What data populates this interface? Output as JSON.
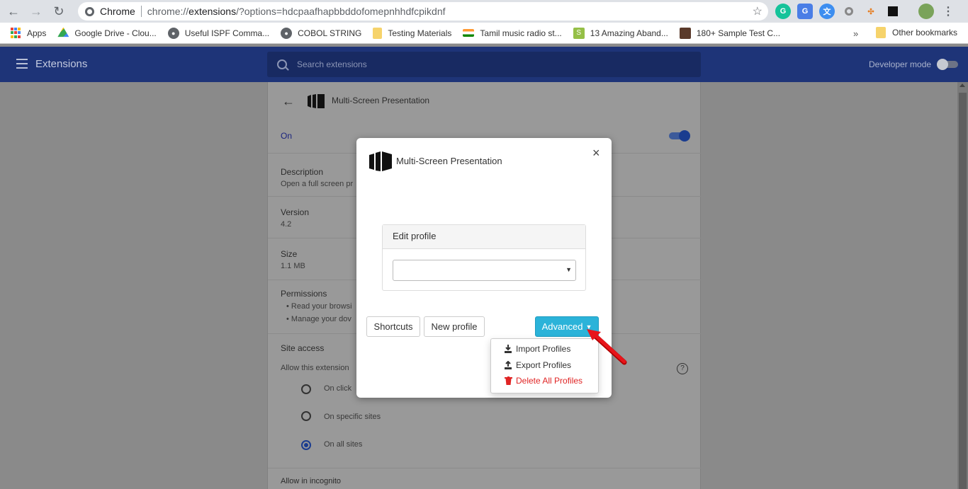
{
  "browser": {
    "omnibox_prefix": "Chrome",
    "url_scheme": "chrome://",
    "url_host": "extensions",
    "url_path": "/?options=hdcpaafhapbbddofomepnhhdfcpikdnf"
  },
  "bookmarks": [
    {
      "label": "Apps",
      "icon": "apps-grid-icon"
    },
    {
      "label": "Google Drive - Clou...",
      "icon": "drive-icon"
    },
    {
      "label": "Useful ISPF Comma...",
      "icon": "globe-icon"
    },
    {
      "label": "COBOL STRING",
      "icon": "globe-icon"
    },
    {
      "label": "Testing Materials",
      "icon": "folder-icon"
    },
    {
      "label": "Tamil music radio st...",
      "icon": "india-flag-icon"
    },
    {
      "label": "13 Amazing Aband...",
      "icon": "shopify-icon"
    },
    {
      "label": "180+ Sample Test C...",
      "icon": "box-icon"
    }
  ],
  "bookmarks_more": "»",
  "bookmarks_other": "Other bookmarks",
  "header": {
    "title": "Extensions",
    "search_placeholder": "Search extensions",
    "developer_mode": "Developer mode"
  },
  "detail": {
    "name": "Multi-Screen Presentation",
    "on_label": "On",
    "description_label": "Description",
    "description_text": "Open a full screen pr",
    "version_label": "Version",
    "version_value": "4.2",
    "size_label": "Size",
    "size_value": "1.1 MB",
    "permissions_label": "Permissions",
    "permissions": [
      "Read your browsi",
      "Manage your dov"
    ],
    "site_access_label": "Site access",
    "allow_label": "Allow this extension",
    "options": [
      "On click",
      "On specific sites",
      "On all sites"
    ],
    "selected_option": "On all sites",
    "incognito_label": "Allow in incognito"
  },
  "modal": {
    "title": "Multi-Screen Presentation",
    "close": "×",
    "panel_title": "Edit profile",
    "select_value": "",
    "select_caret": "▼",
    "buttons": {
      "shortcuts": "Shortcuts",
      "new_profile": "New profile",
      "advanced": "Advanced"
    },
    "dropdown": {
      "import": "Import Profiles",
      "export": "Export Profiles",
      "delete": "Delete All Profiles"
    }
  },
  "colors": {
    "header_bg": "#1e3478",
    "advanced_bg": "#2bb3d9",
    "delete_red": "#e02424",
    "arrow_red": "#e8141a"
  }
}
